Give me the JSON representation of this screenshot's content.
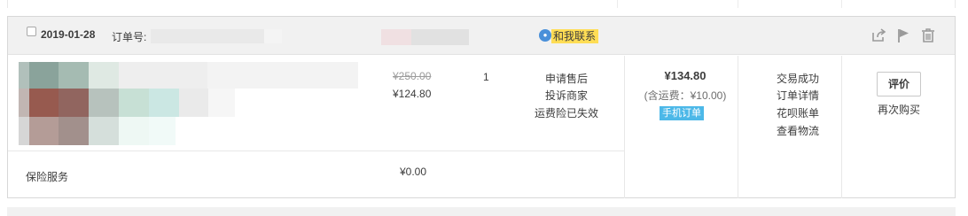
{
  "order": {
    "date": "2019-01-28",
    "order_no_label": "订单号:",
    "contact_label": "和我联系",
    "product": {
      "original_price": "¥250.00",
      "price": "¥124.80",
      "quantity": "1",
      "actions": [
        "申请售后",
        "投诉商家",
        "运费险已失效"
      ]
    },
    "payment": {
      "total": "¥134.80",
      "shipping": "(含运费：¥10.00)",
      "mobile_order_badge": "手机订单"
    },
    "status_links": [
      "交易成功",
      "订单详情",
      "花呗账单",
      "查看物流"
    ],
    "review_button": "评价",
    "rebuy_label": "再次购买",
    "insurance": {
      "label": "保险服务",
      "price": "¥0.00"
    }
  },
  "colors": {
    "header_bg": "#f1f1f1",
    "contact_highlight": "#ffdd55",
    "mobile_badge": "#4cb8e8",
    "border": "#d8d8d8"
  }
}
